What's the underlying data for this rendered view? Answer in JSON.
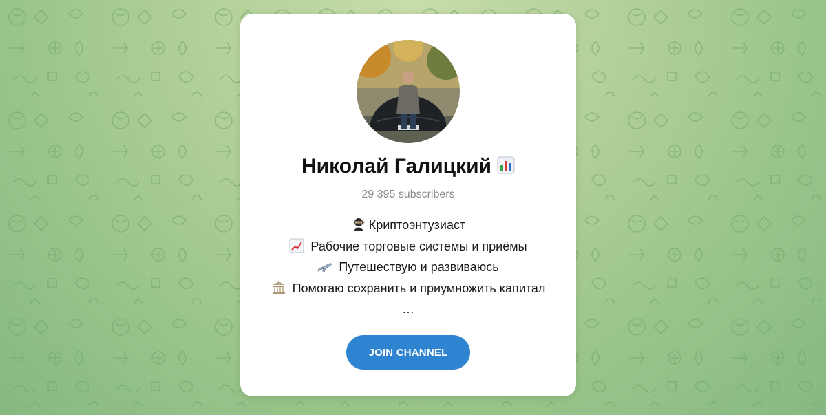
{
  "channel": {
    "name": "Николай Галицкий",
    "title_icon": "bar-chart-icon",
    "subscribers": "29 395 subscribers",
    "description": [
      {
        "icon": "ninja-icon",
        "text": "Криптоэнтузиаст"
      },
      {
        "icon": "chart-increasing-icon",
        "text": " Рабочие торговые системы и приёмы"
      },
      {
        "icon": "airplane-icon",
        "text": " Путешествую и развиваюсь"
      },
      {
        "icon": "classical-building-icon",
        "text": " Помогаю сохранить и приумножить капитал"
      },
      {
        "icon": "",
        "text": "…"
      }
    ]
  },
  "join_button": {
    "label": "JOIN CHANNEL"
  },
  "colors": {
    "button": "#2e84d1",
    "background": "#a9cc93",
    "card": "#ffffff",
    "subtitle": "#8a8a8a"
  }
}
